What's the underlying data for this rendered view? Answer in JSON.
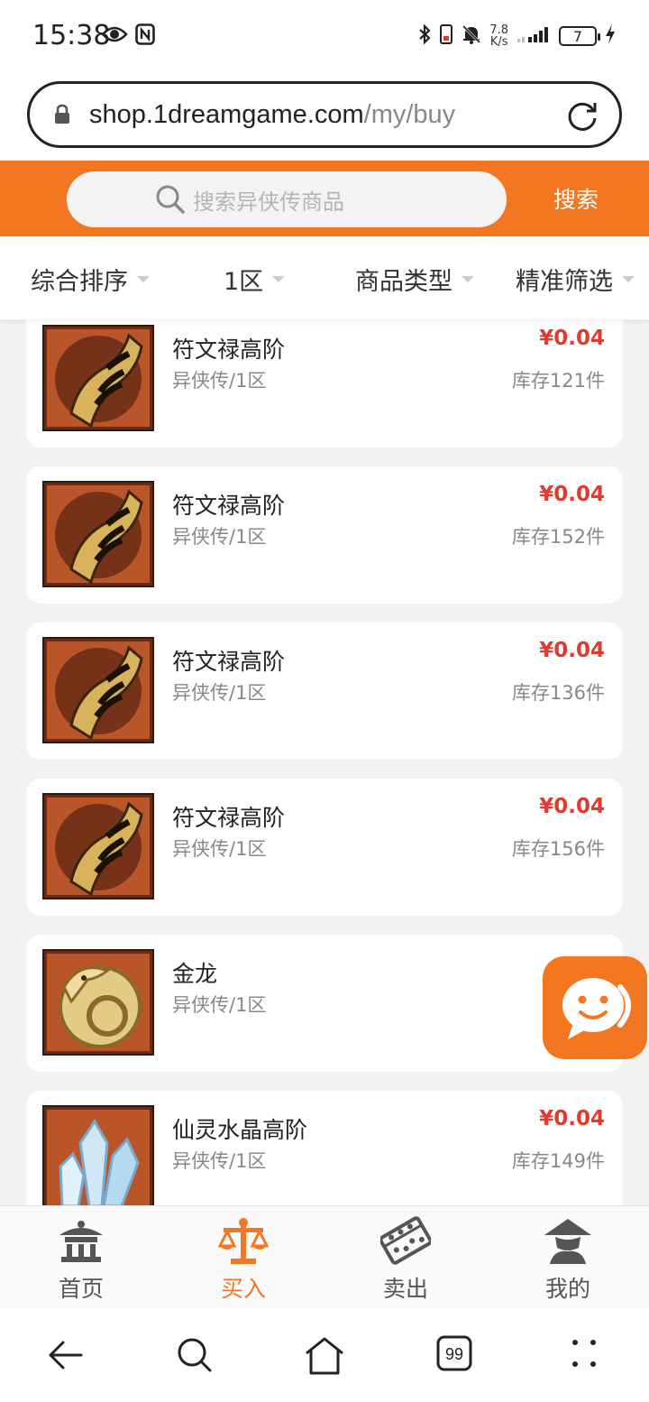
{
  "status_bar": {
    "time": "15:38",
    "speed_top": "7.8",
    "speed_bottom": "K/s",
    "battery": "7"
  },
  "browser": {
    "url_host": "shop.1dreamgame.com",
    "url_path": "/my/buy"
  },
  "search": {
    "placeholder": "搜索异侠传商品",
    "button_label": "搜索"
  },
  "filters": [
    {
      "label": "综合排序"
    },
    {
      "label": "1区"
    },
    {
      "label": "商品类型"
    },
    {
      "label": "精准筛选"
    }
  ],
  "products": [
    {
      "name": "符文禄高阶",
      "sub": "异侠传/1区",
      "price": "¥0.04",
      "stock": "库存121件",
      "icon": "rune-scroll-icon"
    },
    {
      "name": "符文禄高阶",
      "sub": "异侠传/1区",
      "price": "¥0.04",
      "stock": "库存152件",
      "icon": "rune-scroll-icon"
    },
    {
      "name": "符文禄高阶",
      "sub": "异侠传/1区",
      "price": "¥0.04",
      "stock": "库存136件",
      "icon": "rune-scroll-icon"
    },
    {
      "name": "符文禄高阶",
      "sub": "异侠传/1区",
      "price": "¥0.04",
      "stock": "库存156件",
      "icon": "rune-scroll-icon"
    },
    {
      "name": "金龙",
      "sub": "异侠传/1区",
      "price": "",
      "stock": "库",
      "icon": "golden-dragon-icon"
    },
    {
      "name": "仙灵水晶高阶",
      "sub": "异侠传/1区",
      "price": "¥0.04",
      "stock": "库存149件",
      "icon": "crystal-icon"
    }
  ],
  "tabs": [
    {
      "label": "首页",
      "icon": "pavilion-icon"
    },
    {
      "label": "买入",
      "icon": "scale-icon"
    },
    {
      "label": "卖出",
      "icon": "abacus-icon"
    },
    {
      "label": "我的",
      "icon": "straw-hat-person-icon"
    }
  ],
  "android_nav": {
    "tabs_count": "99"
  },
  "colors": {
    "accent": "#f37621",
    "price": "#e03b2e"
  }
}
